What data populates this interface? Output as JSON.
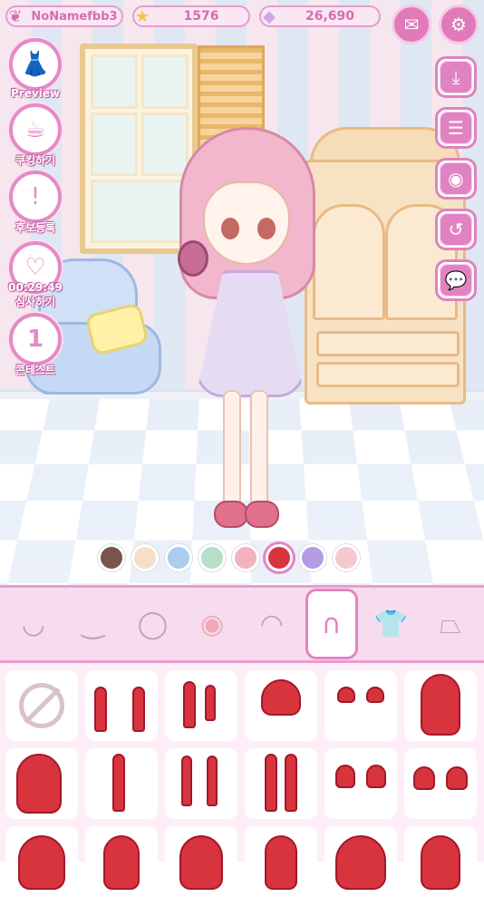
{
  "hud": {
    "username": "NoNamefbb3",
    "stars": "1576",
    "gems": "26,690"
  },
  "left_menu": [
    {
      "label": "Preview",
      "icon": "dress-preview-icon"
    },
    {
      "label": "쿠킹하기",
      "icon": "coffee-cup-icon"
    },
    {
      "label": "후보등록",
      "icon": "exclamation-badge-icon"
    },
    {
      "label": "00:29:49\n심사하기",
      "icon": "judging-icon"
    },
    {
      "label": "콘테스트",
      "icon": "contest-number-one-icon"
    }
  ],
  "left_menu_timer": "00:29:49",
  "left_menu_timer_label": "심사하기",
  "right_menu": [
    {
      "icon": "download-icon"
    },
    {
      "icon": "list-document-icon"
    },
    {
      "icon": "camera-icon"
    },
    {
      "icon": "undo-icon"
    },
    {
      "icon": "speech-bubble-icon"
    }
  ],
  "colors": {
    "accent": "#e583c2",
    "swatches": [
      "#7a5448",
      "#f6dfc9",
      "#a9ccef",
      "#b7dec7",
      "#f3b3be",
      "#d8343d",
      "#b49be6",
      "#f3c9cf"
    ],
    "selected_swatch_index": 5
  },
  "category_tabs": [
    {
      "icon": "eyes-icon"
    },
    {
      "icon": "closed-eyes-icon"
    },
    {
      "icon": "face-shape-icon"
    },
    {
      "icon": "blush-icon"
    },
    {
      "icon": "bangs-icon"
    },
    {
      "icon": "back-hair-icon",
      "active": true
    },
    {
      "icon": "shirt-icon"
    },
    {
      "icon": "skirt-icon"
    }
  ],
  "items": [
    {
      "icon": "none-icon"
    },
    {
      "icon": "long-twin-tails-icon"
    },
    {
      "icon": "side-pony-icon"
    },
    {
      "icon": "bun-updo-icon"
    },
    {
      "icon": "small-buns-icon"
    },
    {
      "icon": "long-straight-hair-icon"
    },
    {
      "icon": "long-hair-icon"
    },
    {
      "icon": "single-tail-icon"
    },
    {
      "icon": "braided-tails-icon"
    },
    {
      "icon": "twin-braids-icon"
    },
    {
      "icon": "curly-tails-icon"
    },
    {
      "icon": "curly-buns-icon"
    },
    {
      "icon": "hair-item-13-icon"
    },
    {
      "icon": "hair-item-14-icon"
    },
    {
      "icon": "hair-item-15-icon"
    },
    {
      "icon": "hair-item-16-icon"
    },
    {
      "icon": "hair-item-17-icon"
    },
    {
      "icon": "hair-item-18-icon"
    }
  ]
}
